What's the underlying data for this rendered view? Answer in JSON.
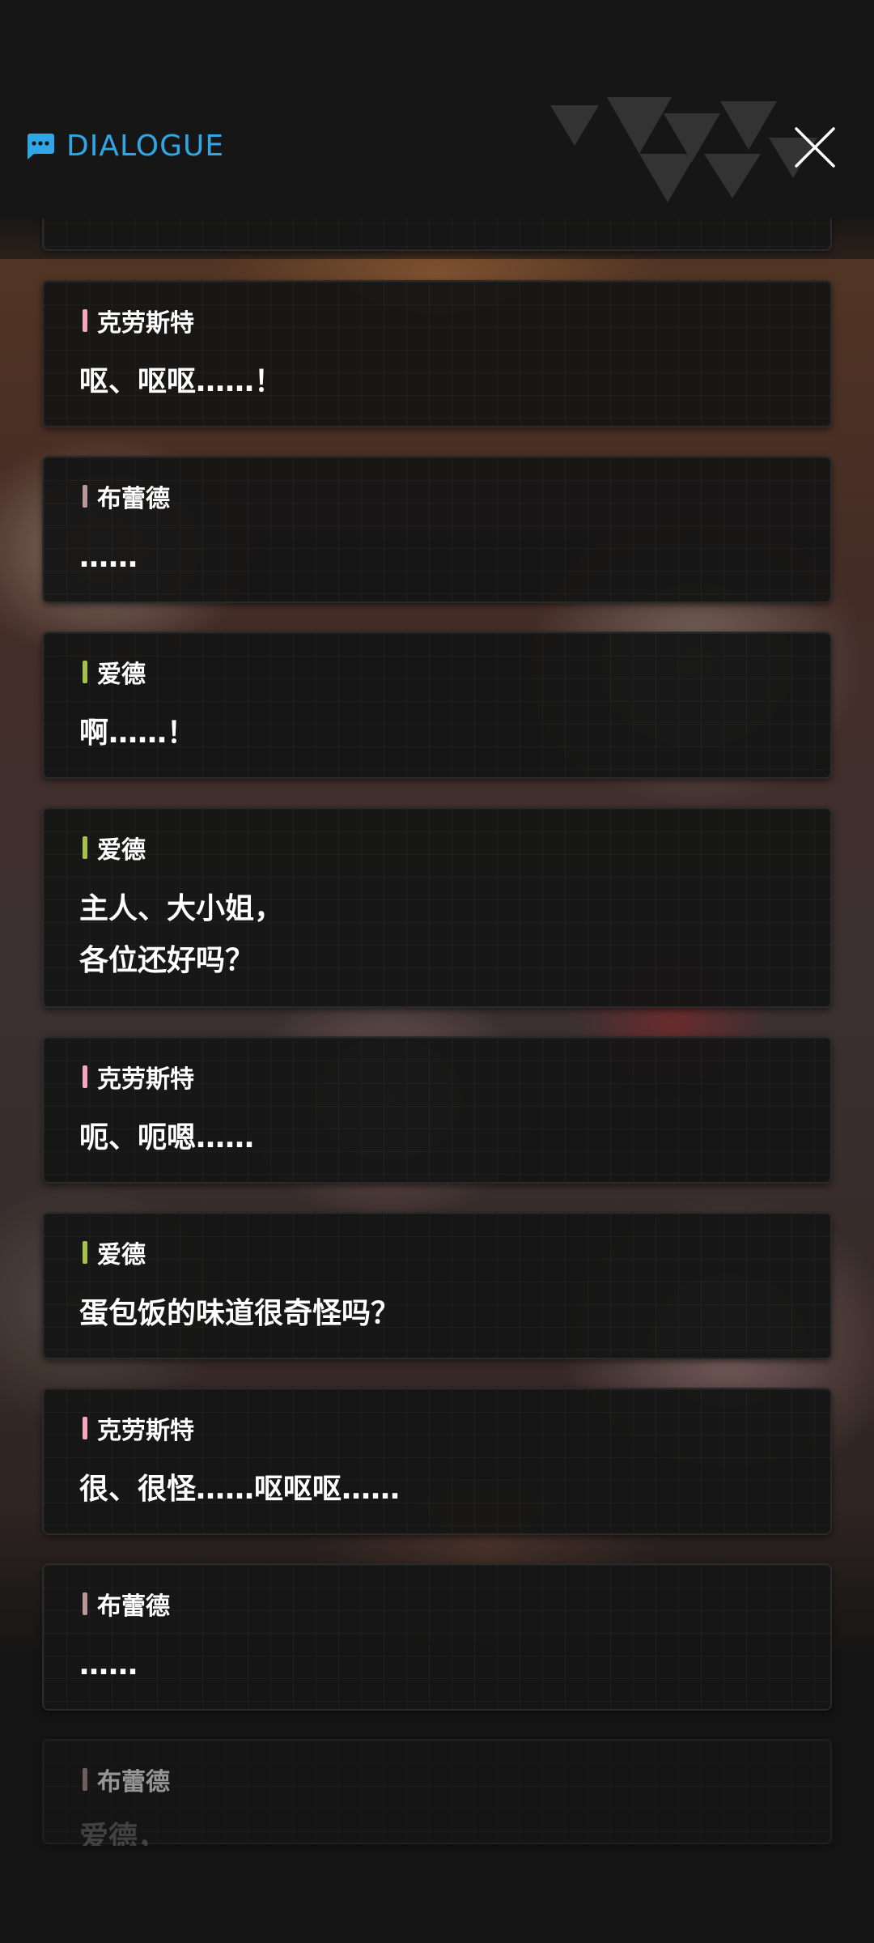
{
  "header": {
    "title": "DIALOGUE",
    "title_color": "#2fa6e6",
    "title_icon": "chat-bubble-icon",
    "close_icon": "close-icon"
  },
  "speaker_colors": {
    "克劳斯特": "#f2a9c0",
    "布蕾德": "#b79a98",
    "爱德": "#a6c24a"
  },
  "entries": [
    {
      "speaker": "克劳斯特",
      "text": "呕、呕呕……！"
    },
    {
      "speaker": "布蕾德",
      "text": "……"
    },
    {
      "speaker": "爱德",
      "text": "啊……！"
    },
    {
      "speaker": "爱德",
      "text": "主人、大小姐，\n各位还好吗？"
    },
    {
      "speaker": "克劳斯特",
      "text": "呃、呃嗯……"
    },
    {
      "speaker": "爱德",
      "text": "蛋包饭的味道很奇怪吗？"
    },
    {
      "speaker": "克劳斯特",
      "text": "很、很怪……呕呕呕……"
    },
    {
      "speaker": "布蕾德",
      "text": "……"
    },
    {
      "speaker": "布蕾德",
      "text": "爱德，"
    }
  ]
}
